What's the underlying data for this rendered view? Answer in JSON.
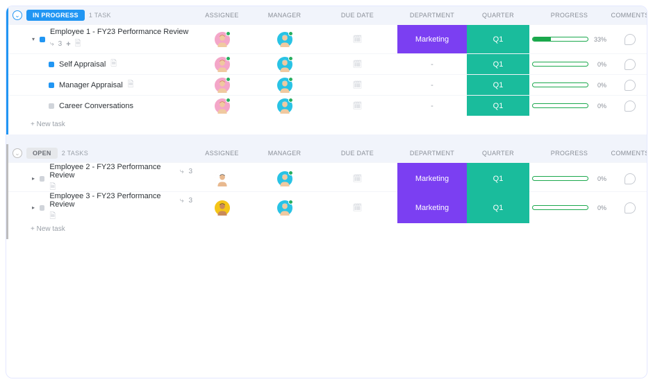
{
  "columns": {
    "assignee": "ASSIGNEE",
    "manager": "MANAGER",
    "due": "DUE DATE",
    "dept": "DEPARTMENT",
    "quarter": "QUARTER",
    "progress": "PROGRESS",
    "comments": "COMMENTS"
  },
  "groups": [
    {
      "status_label": "IN PROGRESS",
      "status_color": "blue",
      "task_count_label": "1 TASK",
      "rows": [
        {
          "type": "parent",
          "expanded": true,
          "status_sq": "blue",
          "title": "Employee 1 - FY23 Performance Review",
          "subtask_count": "3",
          "show_plus": true,
          "show_doc": true,
          "assignee": "f1",
          "manager": "m1",
          "department": "Marketing",
          "quarter": "Q1",
          "progress": 33,
          "progress_label": "33%"
        },
        {
          "type": "sub",
          "status_sq": "blue",
          "title": "Self Appraisal",
          "show_doc": true,
          "assignee": "f1",
          "manager": "m1",
          "department": "-",
          "quarter": "Q1",
          "progress": 0,
          "progress_label": "0%"
        },
        {
          "type": "sub",
          "status_sq": "blue",
          "title": "Manager Appraisal",
          "show_doc": true,
          "assignee": "f1",
          "manager": "m1",
          "department": "-",
          "quarter": "Q1",
          "progress": 0,
          "progress_label": "0%"
        },
        {
          "type": "sub",
          "status_sq": "grey",
          "title": "Career Conversations",
          "show_doc": false,
          "assignee": "f1",
          "manager": "m1",
          "department": "-",
          "quarter": "Q1",
          "progress": 0,
          "progress_label": "0%"
        }
      ],
      "new_task": "+ New task"
    },
    {
      "status_label": "OPEN",
      "status_color": "grey",
      "task_count_label": "2 TASKS",
      "rows": [
        {
          "type": "collapsed-parent",
          "status_sq": "grey",
          "title": "Employee 2 - FY23 Performance Review",
          "subtask_count": "3",
          "show_doc": true,
          "assignee": "f2",
          "manager": "m1",
          "department": "Marketing",
          "quarter": "Q1",
          "progress": 0,
          "progress_label": "0%"
        },
        {
          "type": "collapsed-parent",
          "status_sq": "grey",
          "title": "Employee 3 - FY23 Performance Review",
          "subtask_count": "3",
          "show_doc": true,
          "assignee": "m2",
          "manager": "m1",
          "department": "Marketing",
          "quarter": "Q1",
          "progress": 0,
          "progress_label": "0%"
        }
      ],
      "new_task": "+ New task"
    }
  ],
  "avatars": {
    "f1": {
      "bg": "#f4a6c8",
      "hair": "#c97a3a",
      "skin": "#f0c9a0"
    },
    "f2": {
      "bg": "#ffffff",
      "hair": "#2b2b2b",
      "skin": "#e8b98f"
    },
    "m1": {
      "bg": "#29c3e5",
      "hair": "#d9d9d9",
      "skin": "#f0c9a0"
    },
    "m2": {
      "bg": "#f5c518",
      "hair": "#2b2b2b",
      "skin": "#c98a5a"
    }
  }
}
